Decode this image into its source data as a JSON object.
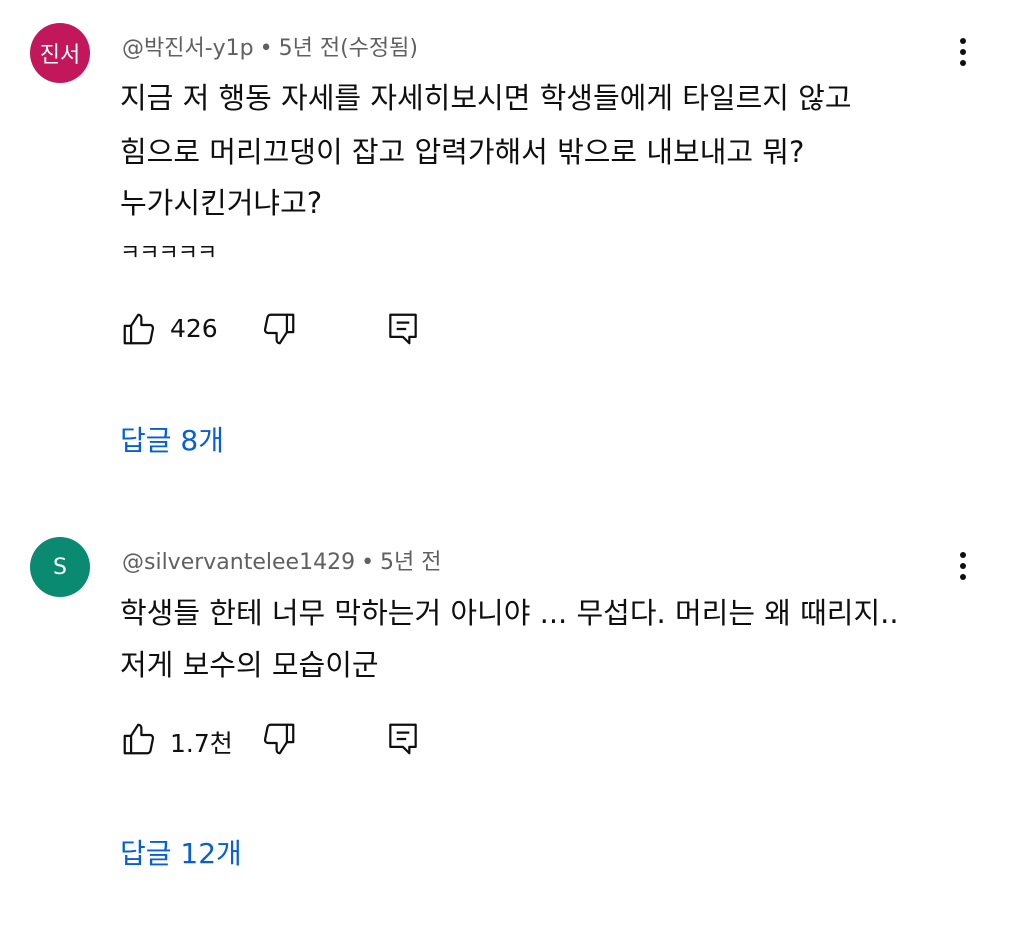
{
  "comments": [
    {
      "avatar": {
        "text": "진서",
        "color": "#c2185b"
      },
      "handle": "@박진서-y1p",
      "separator": "•",
      "time": "5년 전(수정됨)",
      "lines": [
        "지금 저 행동 자세를 자세히보시면 학생들에게 타일르지 않고",
        "힘으로 머리끄댕이 잡고 압력가해서 밖으로 내보내고 뭐?",
        "누가시킨거냐고?"
      ],
      "extra_line": "ㅋㅋㅋㅋㅋ",
      "likes": "426",
      "replies_label": "답글 8개",
      "icons": {
        "more": "more-vert-icon",
        "like": "thumb-up-icon",
        "dislike": "thumb-down-icon",
        "reply": "comment-icon"
      }
    },
    {
      "avatar": {
        "text": "S",
        "color": "#0b8a72"
      },
      "handle": "@silvervantelee1429",
      "separator": "•",
      "time": "5년 전",
      "lines": [
        "학생들 한테 너무 막하는거 아니야 ... 무섭다. 머리는 왜 때리지..",
        "저게 보수의 모습이군"
      ],
      "likes": "1.7천",
      "replies_label": "답글 12개",
      "icons": {
        "more": "more-vert-icon",
        "like": "thumb-up-icon",
        "dislike": "thumb-down-icon",
        "reply": "comment-icon"
      }
    }
  ],
  "colors": {
    "link": "#065fd4",
    "meta": "#606060",
    "text": "#0f0f0f"
  }
}
